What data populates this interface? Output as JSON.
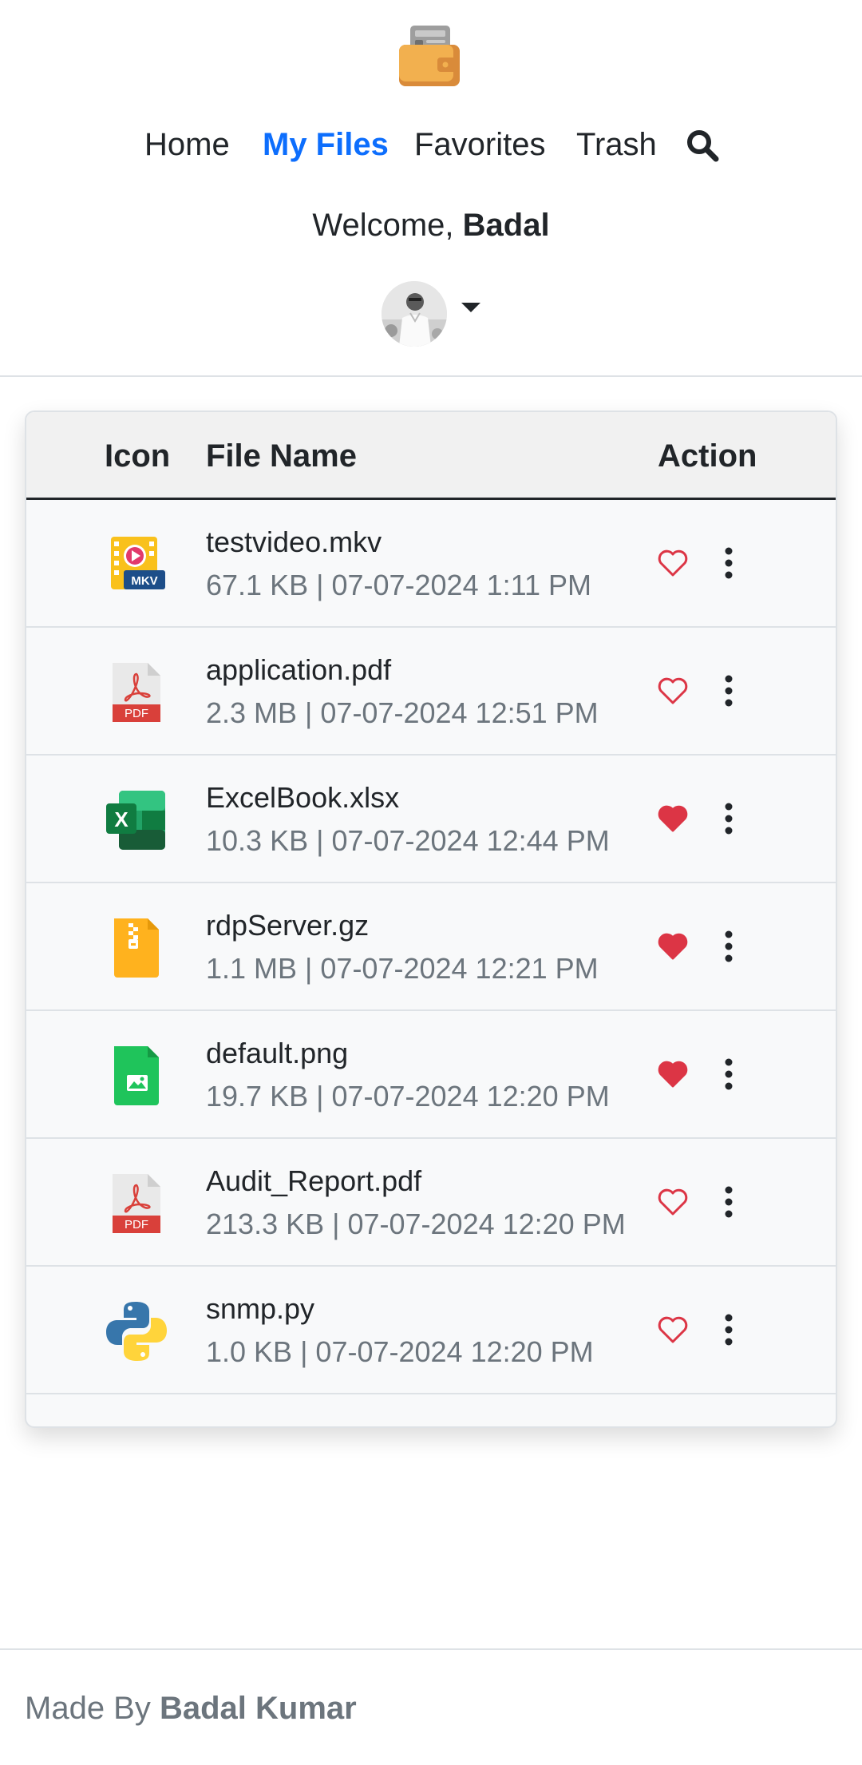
{
  "nav": {
    "home": "Home",
    "my_files": "My Files",
    "favorites": "Favorites",
    "trash": "Trash",
    "search_icon": "search-icon",
    "active_color": "#0d6efd"
  },
  "welcome": {
    "prefix": "Welcome, ",
    "user": "Badal"
  },
  "table": {
    "headers": {
      "icon": "Icon",
      "name": "File Name",
      "action": "Action"
    },
    "rows": [
      {
        "name": "testvideo.mkv",
        "meta": "67.1 KB | 07-07-2024 1:11 PM",
        "icon": "mkv-video-icon",
        "favorite": false
      },
      {
        "name": "application.pdf",
        "meta": "2.3 MB | 07-07-2024 12:51 PM",
        "icon": "pdf-file-icon",
        "favorite": false
      },
      {
        "name": "ExcelBook.xlsx",
        "meta": "10.3 KB | 07-07-2024 12:44 PM",
        "icon": "excel-file-icon",
        "favorite": true
      },
      {
        "name": "rdpServer.gz",
        "meta": "1.1 MB | 07-07-2024 12:21 PM",
        "icon": "archive-file-icon",
        "favorite": true
      },
      {
        "name": "default.png",
        "meta": "19.7 KB | 07-07-2024 12:20 PM",
        "icon": "image-file-icon",
        "favorite": true
      },
      {
        "name": "Audit_Report.pdf",
        "meta": "213.3 KB | 07-07-2024 12:20 PM",
        "icon": "pdf-file-icon",
        "favorite": false
      },
      {
        "name": "snmp.py",
        "meta": "1.0 KB | 07-07-2024 12:20 PM",
        "icon": "python-file-icon",
        "favorite": false
      }
    ]
  },
  "footer": {
    "prefix": "Made By ",
    "author": "Badal Kumar"
  },
  "colors": {
    "heart": "#dc3545",
    "muted_text": "#6c757d"
  }
}
